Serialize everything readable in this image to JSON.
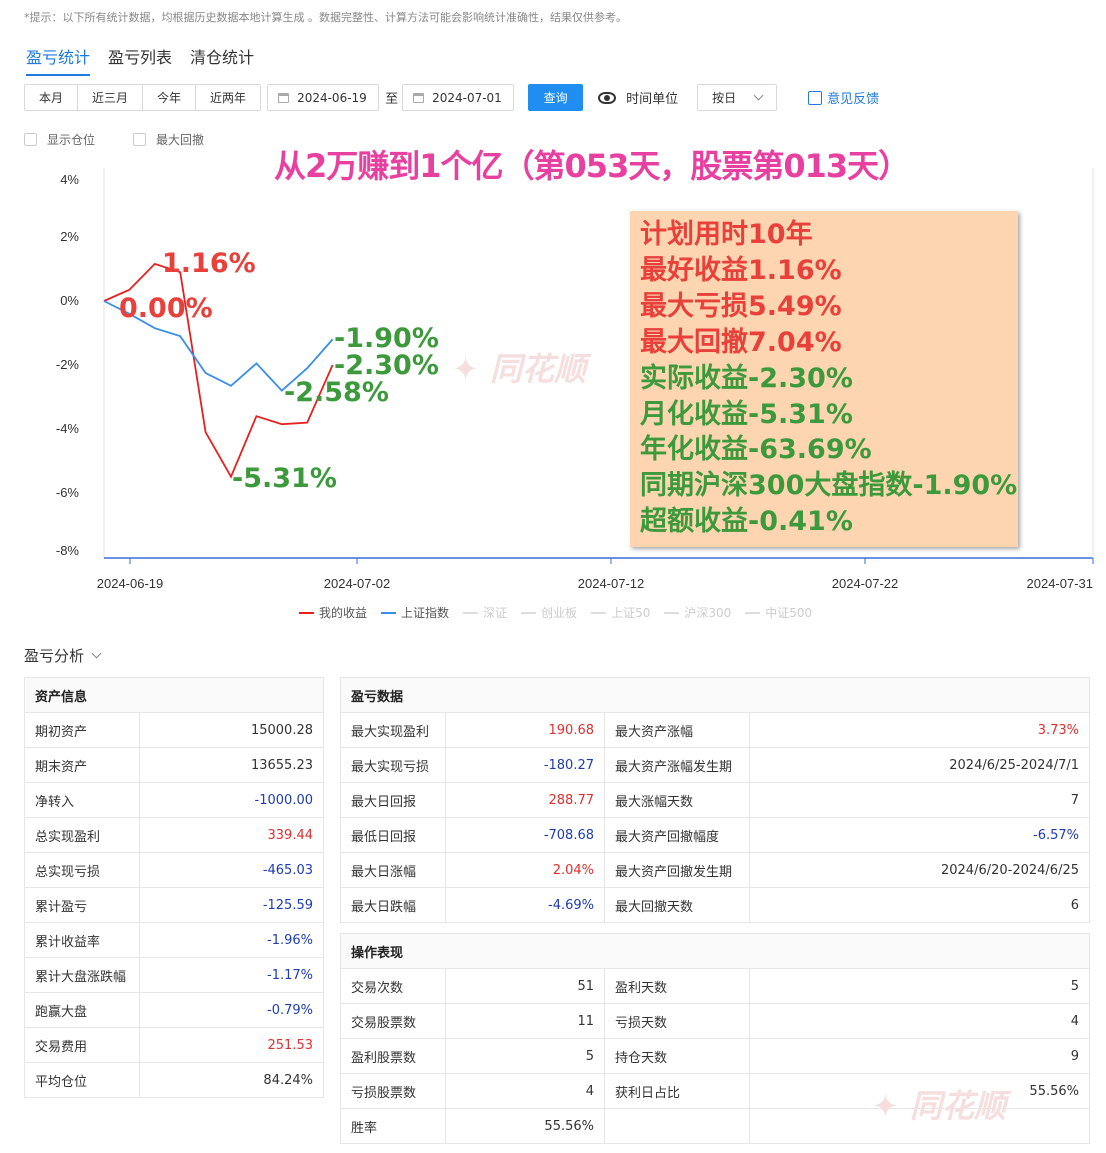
{
  "hint": "*提示：以下所有统计数据，均根据历史数据本地计算生成 。数据完整性、计算方法可能会影响统计准确性，结果仅供参考。",
  "tabs": [
    "盈亏统计",
    "盈亏列表",
    "清仓统计"
  ],
  "toolbar": {
    "ranges": [
      "本月",
      "近三月",
      "今年",
      "近两年"
    ],
    "start_date": "2024-06-19",
    "to": "至",
    "end_date": "2024-07-01",
    "query": "查询",
    "time_unit": "时间单位",
    "unit_value": "按日",
    "feedback": "意见反馈"
  },
  "checks": [
    "显示仓位",
    "最大回撤"
  ],
  "title": "从2万赚到1个亿（第053天，股票第013天）",
  "overlay": [
    {
      "text": "计划用时10年",
      "color": "#e8403a"
    },
    {
      "text": "最好收益1.16%",
      "color": "#e8403a"
    },
    {
      "text": "最大亏损5.49%",
      "color": "#e8403a"
    },
    {
      "text": "最大回撤7.04%",
      "color": "#e8403a"
    },
    {
      "text": "实际收益-2.30%",
      "color": "#3c9a3c"
    },
    {
      "text": "月化收益-5.31%",
      "color": "#3c9a3c"
    },
    {
      "text": "年化收益-63.69%",
      "color": "#3c9a3c"
    },
    {
      "text": "同期沪深300大盘指数-1.90%",
      "color": "#3c9a3c"
    },
    {
      "text": "超额收益-0.41%",
      "color": "#3c9a3c"
    }
  ],
  "chart_data": {
    "type": "line",
    "x_ticks": [
      "2024-06-19",
      "2024-07-02",
      "2024-07-12",
      "2024-07-22",
      "2024-07-31"
    ],
    "y_ticks": [
      "4%",
      "2%",
      "0%",
      "-2%",
      "-4%",
      "-6%",
      "-8%"
    ],
    "ylim": [
      -8,
      4
    ],
    "series": [
      {
        "name": "我的收益",
        "color": "#e82020",
        "values": [
          0,
          0.35,
          1.16,
          0.9,
          -4.1,
          -5.49,
          -3.6,
          -3.85,
          -3.8,
          -2.0
        ]
      },
      {
        "name": "上证指数",
        "color": "#3a8ee8",
        "values": [
          0,
          -0.4,
          -0.85,
          -1.1,
          -2.25,
          -2.65,
          -1.95,
          -2.8,
          -2.1,
          -1.2
        ]
      }
    ],
    "annotations": [
      {
        "text": "1.16%",
        "color": "#e8403a"
      },
      {
        "text": "0.00%",
        "color": "#e8403a"
      },
      {
        "text": "-1.90%",
        "color": "#3c9a3c"
      },
      {
        "text": "-2.30%",
        "color": "#3c9a3c"
      },
      {
        "text": "-2.58%",
        "color": "#3c9a3c"
      },
      {
        "text": "-5.31%",
        "color": "#3c9a3c"
      }
    ],
    "legend": [
      {
        "name": "我的收益",
        "color": "#e82020",
        "active": true
      },
      {
        "name": "上证指数",
        "color": "#3a8ee8",
        "active": true
      },
      {
        "name": "深证",
        "active": false
      },
      {
        "name": "创业板",
        "active": false
      },
      {
        "name": "上证50",
        "active": false
      },
      {
        "name": "沪深300",
        "active": false
      },
      {
        "name": "中证500",
        "active": false
      }
    ]
  },
  "section": "盈亏分析",
  "watermark": "同花顺",
  "asset": {
    "title": "资产信息",
    "rows": [
      [
        "期初资产",
        "15000.28",
        ""
      ],
      [
        "期末资产",
        "13655.23",
        ""
      ],
      [
        "净转入",
        "-1000.00",
        "neg"
      ],
      [
        "总实现盈利",
        "339.44",
        "pos"
      ],
      [
        "总实现亏损",
        "-465.03",
        "neg"
      ],
      [
        "累计盈亏",
        "-125.59",
        "neg"
      ],
      [
        "累计收益率",
        "-1.96%",
        "neg"
      ],
      [
        "累计大盘涨跌幅",
        "-1.17%",
        "neg"
      ],
      [
        "跑赢大盘",
        "-0.79%",
        "neg"
      ],
      [
        "交易费用",
        "251.53",
        "pos"
      ],
      [
        "平均仓位",
        "84.24%",
        ""
      ]
    ]
  },
  "pnl": {
    "title": "盈亏数据",
    "rows": [
      [
        "最大实现盈利",
        "190.68",
        "pos",
        "最大资产涨幅",
        "3.73%",
        "pos"
      ],
      [
        "最大实现亏损",
        "-180.27",
        "neg",
        "最大资产涨幅发生期",
        "2024/6/25-2024/7/1",
        ""
      ],
      [
        "最大日回报",
        "288.77",
        "pos",
        "最大涨幅天数",
        "7",
        ""
      ],
      [
        "最低日回报",
        "-708.68",
        "neg",
        "最大资产回撤幅度",
        "-6.57%",
        "neg"
      ],
      [
        "最大日涨幅",
        "2.04%",
        "pos",
        "最大资产回撤发生期",
        "2024/6/20-2024/6/25",
        ""
      ],
      [
        "最大日跌幅",
        "-4.69%",
        "neg",
        "最大回撤天数",
        "6",
        ""
      ]
    ]
  },
  "ops": {
    "title": "操作表现",
    "rows": [
      [
        "交易次数",
        "51",
        "",
        "盈利天数",
        "5",
        ""
      ],
      [
        "交易股票数",
        "11",
        "",
        "亏损天数",
        "4",
        ""
      ],
      [
        "盈利股票数",
        "5",
        "",
        "持仓天数",
        "9",
        ""
      ],
      [
        "亏损股票数",
        "4",
        "",
        "获利日占比",
        "55.56%",
        ""
      ],
      [
        "胜率",
        "55.56%",
        "",
        "",
        "",
        ""
      ]
    ]
  }
}
